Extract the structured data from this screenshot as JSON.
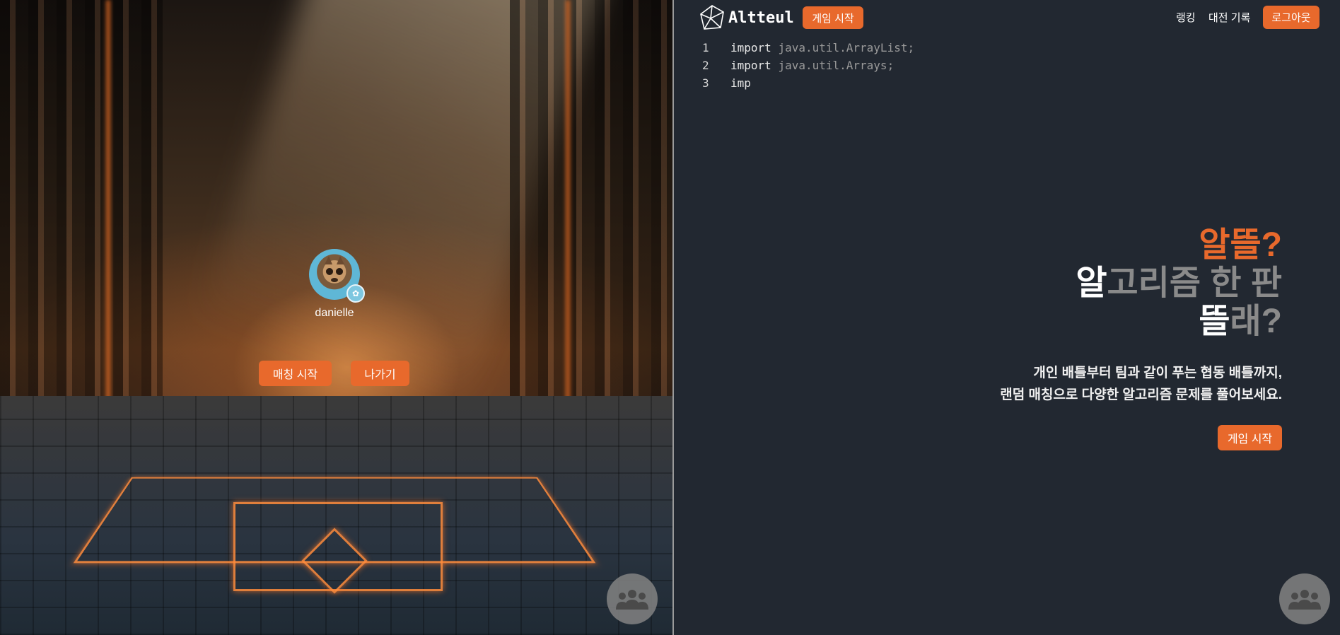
{
  "lobby": {
    "username": "danielle",
    "match_start_label": "매칭 시작",
    "exit_label": "나가기",
    "avatar_icon": "cat-avatar",
    "badge_icon": "flower-badge-icon"
  },
  "header": {
    "logo_text": "Altteul",
    "game_start_label": "게임 시작",
    "ranking_label": "랭킹",
    "history_label": "대전 기록",
    "logout_label": "로그아웃"
  },
  "code_editor": {
    "lines": [
      {
        "num": "1",
        "keyword": "import",
        "rest": "java.util.ArrayList;"
      },
      {
        "num": "2",
        "keyword": "import",
        "rest": "java.util.Arrays;"
      },
      {
        "num": "3",
        "keyword": "imp",
        "rest": ""
      }
    ]
  },
  "hero": {
    "line1": "알뜰?",
    "line2_highlight": "알",
    "line2_rest": "고리즘 한 판",
    "line3_highlight": "뜰",
    "line3_rest": "래?",
    "description_line1": "개인 배틀부터 팀과 같이 푸는 협동 배틀까지,",
    "description_line2": "랜덤 매칭으로 다양한 알고리즘 문제를 풀어보세요.",
    "game_start_label": "게임 시작"
  },
  "colors": {
    "accent": "#e8692c",
    "background": "#222831"
  },
  "fab_icon": "group-people-icon"
}
